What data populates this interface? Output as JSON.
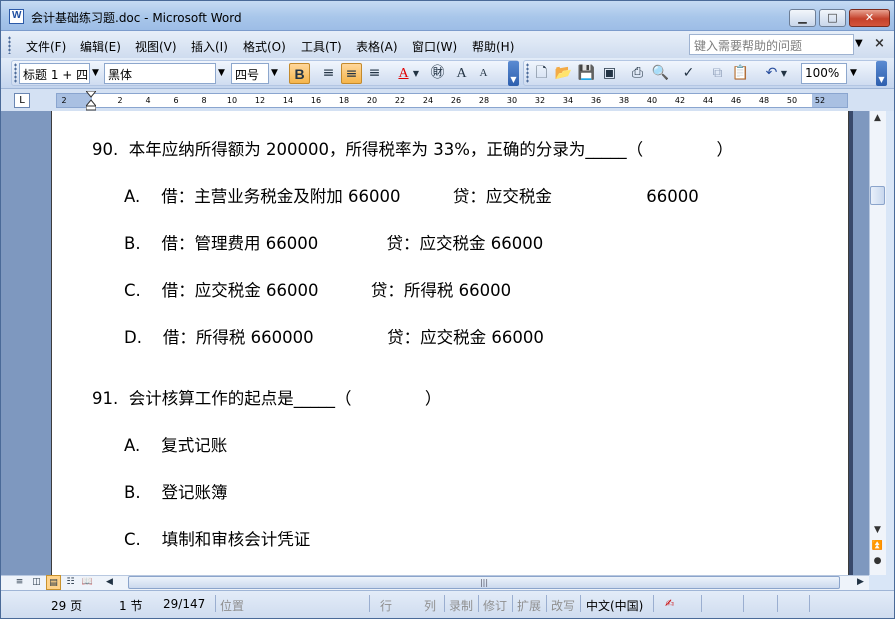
{
  "window": {
    "title": "会计基础练习题.doc - Microsoft Word",
    "min_glyph": "▁",
    "max_glyph": "□",
    "close_glyph": "✕",
    "icon": "word-doc-icon"
  },
  "menu": {
    "items": [
      "文件(F)",
      "编辑(E)",
      "视图(V)",
      "插入(I)",
      "格式(O)",
      "工具(T)",
      "表格(A)",
      "窗口(W)",
      "帮助(H)"
    ],
    "help_placeholder": "键入需要帮助的问题",
    "doc_close": "×"
  },
  "toolbar": {
    "style": "标题 1 + 四",
    "font": "黑体",
    "size": "四号",
    "bold": "B",
    "zoom": "100%",
    "font_color": "#e00000",
    "highlight_color": "#ffd38a",
    "icons": {
      "align_left": "align-left-icon",
      "align_center": "align-center-icon",
      "align_right": "align-right-icon",
      "font_color": "font-color-icon",
      "phonetic": "phonetic-guide-icon",
      "grow_font": "grow-font-icon",
      "shrink_font": "shrink-font-icon",
      "new": "new-doc-icon",
      "open": "open-icon",
      "save": "save-icon",
      "permission": "permission-icon",
      "print": "print-icon",
      "preview": "print-preview-icon",
      "spelling": "spelling-icon",
      "copy": "copy-icon",
      "paste": "paste-icon",
      "undo": "undo-icon"
    }
  },
  "ruler": {
    "selector": "L",
    "labels": [
      "2",
      "2",
      "4",
      "6",
      "8",
      "10",
      "12",
      "14",
      "16",
      "18",
      "20",
      "22",
      "24",
      "26",
      "28",
      "30",
      "32",
      "34",
      "36",
      "38",
      "40",
      "42",
      "44",
      "46",
      "48",
      "50",
      "52"
    ]
  },
  "document": {
    "lines": [
      "90.  本年应纳所得额为 200000，所得税率为 33%，正确的分录为_____（              ）",
      "A.    借：主营业务税金及附加 66000          贷：应交税金                  66000",
      "B.    借：管理费用 66000             贷：应交税金 66000",
      "C.    借：应交税金 66000          贷：所得税 66000",
      "D.    借：所得税 660000              贷：应交税金 66000",
      "91.  会计核算工作的起点是_____（              ）",
      "A.    复式记账",
      "B.    登记账簿",
      "C.    填制和审核会计凭证"
    ]
  },
  "status": {
    "page": "29 页",
    "section": "1 节",
    "page_of": "29/147",
    "position": "位置",
    "line": "行",
    "column": "列",
    "record": "录制",
    "revision": "修订",
    "extend": "扩展",
    "overtype": "改写",
    "language": "中文(中国)",
    "spell_icon": "spelling-status-icon"
  }
}
